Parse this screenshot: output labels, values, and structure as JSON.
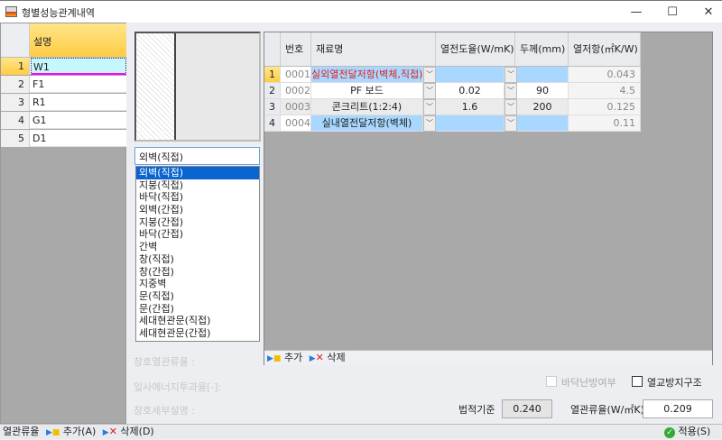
{
  "window": {
    "title": "형별성능관계내역",
    "minimize": "—",
    "maximize": "☐",
    "close": "✕"
  },
  "left_grid": {
    "header": "설명",
    "rows": [
      {
        "num": "1",
        "value": "W1"
      },
      {
        "num": "2",
        "value": "F1"
      },
      {
        "num": "3",
        "value": "R1"
      },
      {
        "num": "4",
        "value": "G1"
      },
      {
        "num": "5",
        "value": "D1"
      }
    ]
  },
  "type_select": {
    "value": "외벽(직접)",
    "options": [
      "외벽(직접)",
      "지붕(직접)",
      "바닥(직접)",
      "외벽(간접)",
      "지붕(간접)",
      "바닥(간접)",
      "간벽",
      "창(직접)",
      "창(간접)",
      "지중벽",
      "문(직접)",
      "문(간접)",
      "세대현관문(직접)",
      "세대현관문(간접)"
    ]
  },
  "layer_grid": {
    "headers": [
      "번호",
      "재료명",
      "열전도율(W/mK)",
      "두께(mm)",
      "열저항(㎡K/W)"
    ],
    "rows": [
      {
        "row": "1",
        "no": "0001",
        "material": "실외열전달저항(벽체,직접)",
        "conductivity": "",
        "thickness": "",
        "resistance": "0.043"
      },
      {
        "row": "2",
        "no": "0002",
        "material": "PF 보드",
        "conductivity": "0.02",
        "thickness": "90",
        "resistance": "4.5"
      },
      {
        "row": "3",
        "no": "0003",
        "material": "콘크리트(1:2:4)",
        "conductivity": "1.6",
        "thickness": "200",
        "resistance": "0.125"
      },
      {
        "row": "4",
        "no": "0004",
        "material": "실내열전달저항(벽체)",
        "conductivity": "",
        "thickness": "",
        "resistance": "0.11"
      }
    ],
    "add": "추가",
    "delete": "삭제"
  },
  "form": {
    "window_u_label": "창호열관류율 :",
    "solar_label": "일사에너지투과율[-]:",
    "window_desc_label": "창호세부설명 :",
    "floor_heating": "바닥난방여부",
    "thermal_bridge": "열교방지구조",
    "legal_label": "법적기준",
    "legal_value": "0.240",
    "u_label": "열관류율(W/㎡K)",
    "u_value": "0.209"
  },
  "status": {
    "label": "열관류율",
    "add": "추가(A)",
    "delete": "삭제(D)",
    "apply": "적용(S)"
  },
  "colors": {
    "accent_yellow": "#ffcc44",
    "selected_blue": "#0a64d0",
    "cell_blue": "#a8d8ff",
    "red_text": "#e02020"
  }
}
